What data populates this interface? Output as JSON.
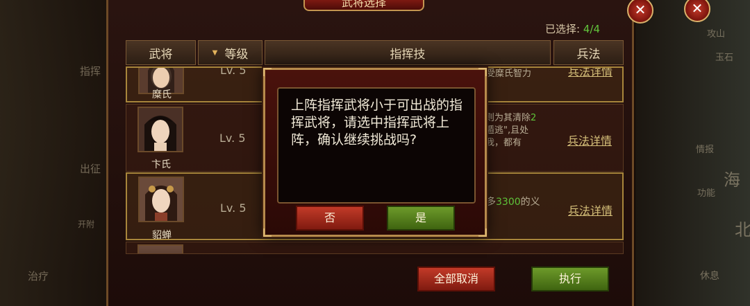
{
  "window": {
    "title": "武将选择",
    "close_symbol": "✕"
  },
  "selection": {
    "label": "已选择:",
    "count": "4/4"
  },
  "columns": [
    {
      "label": "武将"
    },
    {
      "label": "等级",
      "sort_indicator": "▼"
    },
    {
      "label": "指挥技"
    },
    {
      "label": "兵法"
    }
  ],
  "generals": [
    {
      "name": "糜氏",
      "level": "Lv. 5",
      "skill_text": "受糜氏智力",
      "tactic_link": "兵法详情",
      "highlighted": true
    },
    {
      "name": "卞氏",
      "level": "Lv. 5",
      "skill_line1": "则为其清除",
      "skill_num": "2",
      "skill_line2": "遁逃\",且处",
      "skill_line3": "我，都有",
      "tactic_link": "兵法详情",
      "highlighted": false
    },
    {
      "name": "貂蝉",
      "level": "Lv. 5",
      "skill_prefix": "多",
      "skill_num": "3300",
      "skill_suffix": "的义",
      "tactic_link": "兵法详情",
      "highlighted": true
    }
  ],
  "dialog": {
    "message": "上阵指挥武将小于可出战的指挥武将，请选中指挥武将上阵，确认继续挑战吗?",
    "no_label": "否",
    "yes_label": "是"
  },
  "footer": {
    "cancel_all_label": "全部取消",
    "execute_label": "执行"
  },
  "background": {
    "left_labels": [
      "指挥",
      "出征",
      "开附",
      "治疗"
    ],
    "right_labels": [
      "攻山",
      "玉石",
      "情报",
      "海",
      "功能",
      "北",
      "休息"
    ]
  },
  "colors": {
    "accent_green": "#5fc43a",
    "button_red": "#c23a28",
    "button_green": "#6d9a2a",
    "gold_border": "#b78b4c"
  }
}
